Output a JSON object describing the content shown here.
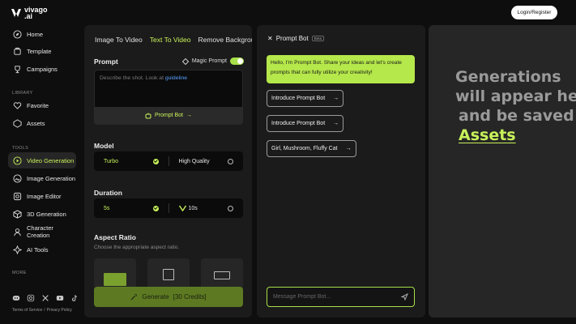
{
  "brand": {
    "line1": "vivago",
    "line2": ".ai"
  },
  "header": {
    "login_label": "Login/Register"
  },
  "sidebar": {
    "main": [
      {
        "label": "Home",
        "icon": "compass-icon"
      },
      {
        "label": "Template",
        "icon": "template-icon"
      },
      {
        "label": "Campaigns",
        "icon": "trophy-icon"
      }
    ],
    "library_label": "LIBRARY",
    "library": [
      {
        "label": "Favorite",
        "icon": "heart-icon"
      },
      {
        "label": "Assets",
        "icon": "assets-icon"
      }
    ],
    "tools_label": "TOOLS",
    "tools": [
      {
        "label": "Video Generation",
        "icon": "video-icon",
        "active": true
      },
      {
        "label": "Image Generation",
        "icon": "image-icon"
      },
      {
        "label": "Image Editor",
        "icon": "editor-icon"
      },
      {
        "label": "3D Generation",
        "icon": "cube-icon"
      },
      {
        "label": "Character Creation",
        "icon": "person-icon"
      },
      {
        "label": "AI Tools",
        "icon": "tools-icon"
      }
    ],
    "more_label": "MORE",
    "footer": {
      "terms": "Terms of Service",
      "sep": "/",
      "privacy": "Privacy Policy"
    }
  },
  "panel1": {
    "tabs": [
      "Image To Video",
      "Text To Video",
      "Remove Background"
    ],
    "active_tab": "Text To Video",
    "prompt_label": "Prompt",
    "magic_prompt_label": "Magic Prompt",
    "prompt_placeholder": "Describe the shot. Look at ",
    "prompt_link": "guideline",
    "prompt_bot_label": "Prompt Bot",
    "model_label": "Model",
    "model_options": [
      {
        "label": "Turbo",
        "selected": true
      },
      {
        "label": "High Quality",
        "selected": false
      }
    ],
    "duration_label": "Duration",
    "duration_options": [
      {
        "label": "5s",
        "selected": true
      },
      {
        "label": "10s",
        "selected": false
      }
    ],
    "aspect_label": "Aspect Ratio",
    "aspect_hint": "Choose the appropriate aspect ratio.",
    "generate_label": "Generate",
    "generate_credits": "[30 Credits]"
  },
  "panel2": {
    "title": "Prompt Bot",
    "badge": "Beta",
    "message": "Hello, I'm Prompt Bot. Share your ideas and let's create prompts that can fully utilize your creativity!",
    "chips": [
      "Introduce Prompt Bot",
      "Introduce Prompt Bot",
      "Girl, Mushroom, Fluffy Cat"
    ],
    "input_placeholder": "Message Prompt Bot..."
  },
  "panel3": {
    "line1": "Generations",
    "line2": "will appear here",
    "line3": "and be saved to",
    "assets_word": "Assets"
  },
  "colors": {
    "accent": "#c8f25a",
    "panel": "#1b1b1b",
    "background": "#0e0e0e"
  }
}
